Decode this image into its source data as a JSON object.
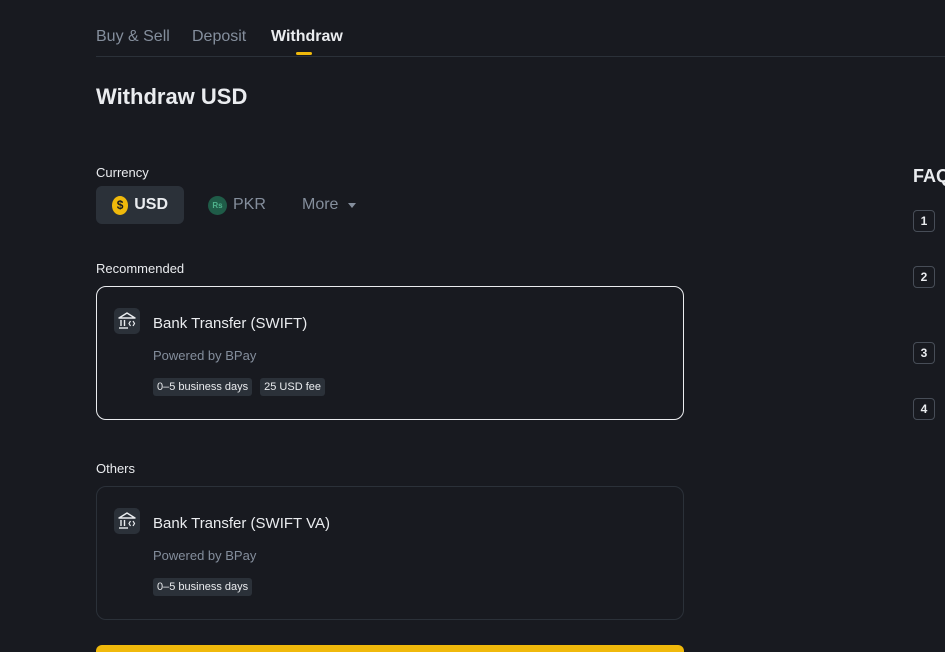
{
  "tabs": [
    {
      "label": "Buy & Sell",
      "active": false
    },
    {
      "label": "Deposit",
      "active": false
    },
    {
      "label": "Withdraw",
      "active": true
    }
  ],
  "title": "Withdraw USD",
  "currency": {
    "label": "Currency",
    "options": [
      {
        "code": "USD",
        "icon": "dollar-coin-icon",
        "symbol": "$",
        "selected": true
      },
      {
        "code": "PKR",
        "icon": "rupee-coin-icon",
        "symbol": "Rs",
        "selected": false
      }
    ],
    "more_label": "More"
  },
  "recommended": {
    "label": "Recommended",
    "methods": [
      {
        "title": "Bank Transfer (SWIFT)",
        "provider": "Powered by BPay",
        "tags": [
          "0–5 business days",
          "25 USD fee"
        ],
        "icon": "bank-icon",
        "selected": true
      }
    ]
  },
  "others": {
    "label": "Others",
    "methods": [
      {
        "title": "Bank Transfer (SWIFT VA)",
        "provider": "Powered by BPay",
        "tags": [
          "0–5 business days"
        ],
        "icon": "bank-icon",
        "selected": false
      }
    ]
  },
  "faq": {
    "title": "FAQ",
    "items": [
      "1",
      "2",
      "3",
      "4"
    ]
  },
  "colors": {
    "background": "#181a20",
    "accent": "#f0b90b",
    "surface": "#2b3139",
    "muted_text": "#848e9c"
  }
}
